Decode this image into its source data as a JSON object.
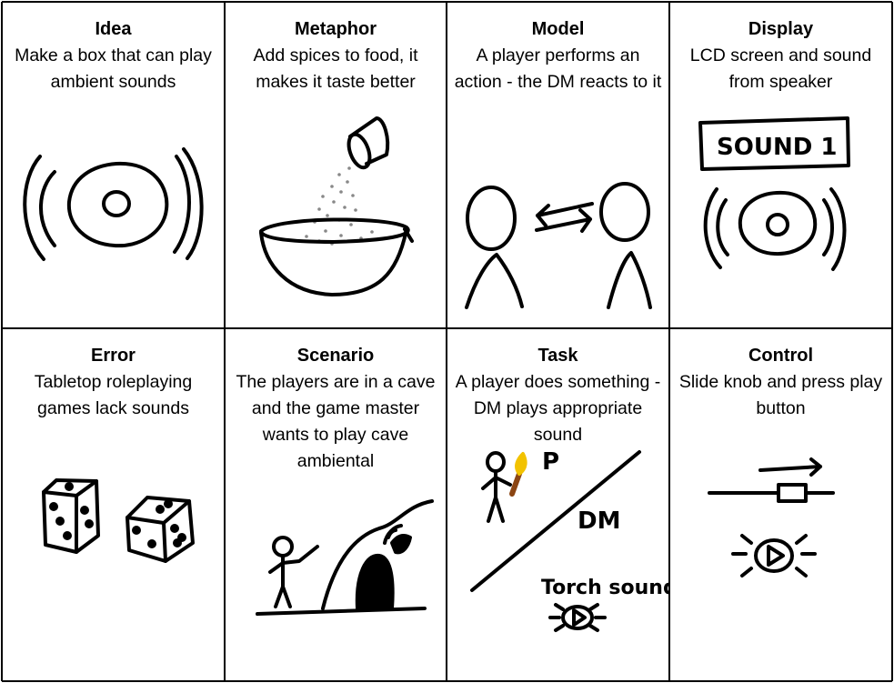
{
  "cells": [
    {
      "title": "Idea",
      "desc": "Make a box that can play ambient sounds"
    },
    {
      "title": "Metaphor",
      "desc": "Add spices to food, it makes it taste better"
    },
    {
      "title": "Model",
      "desc": "A player performs an action - the DM reacts to it"
    },
    {
      "title": "Display",
      "desc": "LCD screen and sound from speaker"
    },
    {
      "title": "Error",
      "desc": "Tabletop roleplaying games lack sounds"
    },
    {
      "title": "Scenario",
      "desc": "The players are in a cave and the game master  wants to play cave ambiental"
    },
    {
      "title": "Task",
      "desc": "A player does something - DM plays appropriate sound"
    },
    {
      "title": "Control",
      "desc": "Slide knob and press play button"
    }
  ],
  "sketch_labels": {
    "display_screen": "SOUND 1",
    "task_player": "P",
    "task_dm": "DM",
    "task_sound": "Torch sound"
  },
  "colors": {
    "torch_flame": "#f2c200",
    "torch_handle": "#8b4513",
    "salt": "#888888"
  }
}
